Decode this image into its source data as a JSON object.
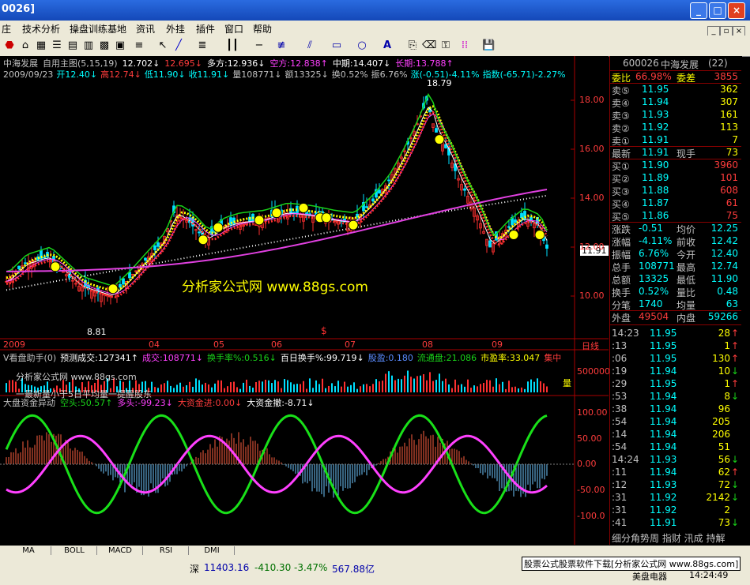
{
  "window": {
    "title": "0026]"
  },
  "menu": [
    "庄",
    "技术分析",
    "操盘训练基地",
    "资讯",
    "外挂",
    "插件",
    "窗口",
    "帮助"
  ],
  "chart_header": {
    "line1": [
      {
        "t": "中海发展",
        "c": "gry"
      },
      {
        "t": "自用主图(5,15,19)",
        "c": "gry"
      },
      {
        "t": "12.702↓",
        "c": "wht"
      },
      {
        "t": "12.695↓",
        "c": "red"
      },
      {
        "t": "多方:12.936↓",
        "c": "wht"
      },
      {
        "t": "空方:12.838↑",
        "c": "mag"
      },
      {
        "t": "中期:14.407↓",
        "c": "wht"
      },
      {
        "t": "长期:13.788↑",
        "c": "mag"
      }
    ],
    "line2": [
      {
        "t": "2009/09/23",
        "c": "gry"
      },
      {
        "t": "开12.40↓",
        "c": "cyn"
      },
      {
        "t": "高12.74↓",
        "c": "red"
      },
      {
        "t": "低11.90↓",
        "c": "cyn"
      },
      {
        "t": "收11.91↓",
        "c": "cyn"
      },
      {
        "t": "量108771↓",
        "c": "gry"
      },
      {
        "t": "额13325↓",
        "c": "gry"
      },
      {
        "t": "换0.52%",
        "c": "gry"
      },
      {
        "t": "振6.76%",
        "c": "gry"
      },
      {
        "t": "涨(-0.51)-4.11%",
        "c": "cyn"
      },
      {
        "t": "指数(-65.71)-2.27%",
        "c": "cyn"
      }
    ]
  },
  "price_axis": [
    "18.00",
    "16.00",
    "14.00",
    "12.00",
    "10.00"
  ],
  "current_price_tag": "11.91",
  "hi_marker": "18.79",
  "lo_marker": "8.81",
  "watermark": "分析家公式网 www.88gs.com",
  "dates": [
    "2009",
    "04",
    "05",
    "06",
    "07",
    "08",
    "09"
  ],
  "date_unit": "日线",
  "vol_header": [
    {
      "t": "V看盘助手(0)",
      "c": "gry"
    },
    {
      "t": "预测成交:127341↑",
      "c": "wht"
    },
    {
      "t": "成交:108771↓",
      "c": "mag"
    },
    {
      "t": "换手率%:0.516↓",
      "c": "grn"
    },
    {
      "t": "百日换手%:99.719↓",
      "c": "wht"
    },
    {
      "t": "股盈:0.180",
      "c": "blu"
    },
    {
      "t": "流通盘:21.086",
      "c": "grn"
    },
    {
      "t": "市盈率:33.047",
      "c": "yel"
    },
    {
      "t": "集中",
      "c": "red"
    }
  ],
  "vol_axis": [
    "500000"
  ],
  "vol_wm": "分析家公式网 www.88gs.com",
  "vol_caption": "一最新量小于5日平均量一提醒股东",
  "vol_unit": "量",
  "osc_header": [
    {
      "t": "大盘资金异动",
      "c": "gry"
    },
    {
      "t": "空头:50.57↑",
      "c": "grn"
    },
    {
      "t": "多头:-99.23↓",
      "c": "mag"
    },
    {
      "t": "大资金进:0.00↓",
      "c": "red"
    },
    {
      "t": "大资金撤:-8.71↓",
      "c": "wht"
    }
  ],
  "osc_axis": [
    "100.00",
    "50.00",
    "0.00",
    "-50.00",
    "-100.0"
  ],
  "tabs": [
    "MA",
    "BOLL",
    "MACD",
    "RSI",
    "DMI"
  ],
  "quote": {
    "code": "600026",
    "name": "中海发展",
    "count": "(22)",
    "weibi": {
      "label": "委比",
      "val": "66.98%",
      "label2": "委差",
      "val2": "3855"
    },
    "sells": [
      [
        "卖⑤",
        "11.95",
        "362"
      ],
      [
        "卖④",
        "11.94",
        "307"
      ],
      [
        "卖③",
        "11.93",
        "161"
      ],
      [
        "卖②",
        "11.92",
        "113"
      ],
      [
        "卖①",
        "11.91",
        "7"
      ]
    ],
    "latest": {
      "label": "最新",
      "val": "11.91",
      "label2": "现手",
      "val2": "73"
    },
    "buys": [
      [
        "买①",
        "11.90",
        "3960"
      ],
      [
        "买②",
        "11.89",
        "101"
      ],
      [
        "买③",
        "11.88",
        "608"
      ],
      [
        "买④",
        "11.87",
        "61"
      ],
      [
        "买⑤",
        "11.86",
        "75"
      ]
    ],
    "stats": [
      [
        "涨跌",
        "-0.51",
        "均价",
        "12.25"
      ],
      [
        "涨幅",
        "-4.11%",
        "前收",
        "12.42"
      ],
      [
        "振幅",
        "6.76%",
        "今开",
        "12.40"
      ],
      [
        "总手",
        "108771",
        "最高",
        "12.74"
      ],
      [
        "总额",
        "13325",
        "最低",
        "11.90"
      ],
      [
        "换手",
        "0.52%",
        "量比",
        "0.48"
      ],
      [
        "分笔",
        "1740",
        "均量",
        "63"
      ]
    ],
    "outer": {
      "label": "外盘",
      "val": "49504",
      "label2": "内盘",
      "val2": "59266"
    },
    "ticks": [
      [
        "14:23",
        "11.95",
        "28",
        "up"
      ],
      [
        ":13",
        "11.95",
        "1",
        "up"
      ],
      [
        ":06",
        "11.95",
        "130",
        "up"
      ],
      [
        ":19",
        "11.94",
        "10",
        "dn"
      ],
      [
        ":29",
        "11.95",
        "1",
        "up"
      ],
      [
        ":53",
        "11.94",
        "8",
        "dn"
      ],
      [
        ":38",
        "11.94",
        "96",
        ""
      ],
      [
        ":54",
        "11.94",
        "205",
        ""
      ],
      [
        ":14",
        "11.94",
        "206",
        ""
      ],
      [
        ":54",
        "11.94",
        "51",
        ""
      ],
      [
        "14:24",
        "11.93",
        "56",
        "dn"
      ],
      [
        ":11",
        "11.94",
        "62",
        "up"
      ],
      [
        ":12",
        "11.93",
        "72",
        "dn"
      ],
      [
        ":31",
        "11.92",
        "2142",
        "dn"
      ],
      [
        ":31",
        "11.92",
        "2",
        ""
      ],
      [
        ":41",
        "11.91",
        "73",
        "dn"
      ]
    ],
    "footer": "细分角势周 指财 汛成 持解"
  },
  "status": {
    "index_label": "深",
    "index_val": "11403.16",
    "index_chg": "-410.30",
    "index_pct": "-3.47%",
    "index_amt": "567.88亿",
    "ad": "股票公式股票软件下载[分析家公式网 www.88gs.com]",
    "time": "14:24:49",
    "bottom_left": "美盘电器"
  }
}
